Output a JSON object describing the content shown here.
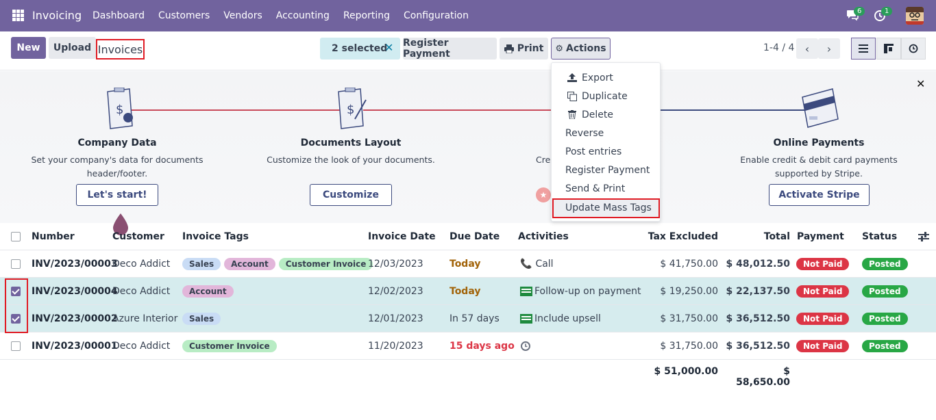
{
  "topbar": {
    "brand": "Invoicing",
    "menu": [
      "Dashboard",
      "Customers",
      "Vendors",
      "Accounting",
      "Reporting",
      "Configuration"
    ],
    "chat_count": "6",
    "activity_count": "1",
    "bg_color": "#71639e"
  },
  "control_panel": {
    "new_label": "New",
    "upload_label": "Upload",
    "breadcrumb": "Invoices",
    "selected_label": "2 selected",
    "register_payment_label": "Register Payment",
    "print_label": "Print",
    "actions_label": "Actions",
    "pager": "1-4 / 4"
  },
  "actions_menu": {
    "items": [
      {
        "label": "Export",
        "icon": "upload-icon"
      },
      {
        "label": "Duplicate",
        "icon": "copy-icon"
      },
      {
        "label": "Delete",
        "icon": "trash-icon"
      },
      {
        "label": "Reverse",
        "icon": ""
      },
      {
        "label": "Post entries",
        "icon": ""
      },
      {
        "label": "Register Payment",
        "icon": ""
      },
      {
        "label": "Send & Print",
        "icon": ""
      },
      {
        "label": "Update Mass Tags",
        "icon": ""
      }
    ]
  },
  "onboarding": {
    "steps": [
      {
        "title": "Company Data",
        "desc": "Set your company's data for documents header/footer.",
        "button": "Let's start!"
      },
      {
        "title": "Documents Layout",
        "desc": "Customize the look of your documents.",
        "button": "Customize"
      },
      {
        "title": "",
        "desc": "Crea",
        "button": ""
      },
      {
        "title": "Online Payments",
        "desc": "Enable credit & debit card payments supported by Stripe.",
        "button": "Activate Stripe"
      }
    ]
  },
  "table": {
    "headers": {
      "number": "Number",
      "customer": "Customer",
      "tags": "Invoice Tags",
      "invoice_date": "Invoice Date",
      "due_date": "Due Date",
      "activities": "Activities",
      "tax_excluded": "Tax Excluded",
      "total": "Total",
      "payment": "Payment",
      "status": "Status"
    },
    "rows": [
      {
        "number": "INV/2023/00003",
        "customer": "Deco Addict",
        "tags": [
          "Sales",
          "Account",
          "Customer Invoice"
        ],
        "invoice_date": "12/03/2023",
        "due_date": "Today",
        "activity": "Call",
        "activity_icon": "phone-icon",
        "tax_excluded": "$ 41,750.00",
        "total": "$ 48,012.50",
        "payment": "Not Paid",
        "status": "Posted",
        "selected": false
      },
      {
        "number": "INV/2023/00004",
        "customer": "Deco Addict",
        "tags": [
          "Account"
        ],
        "invoice_date": "12/02/2023",
        "due_date": "Today",
        "activity": "Follow-up on payment",
        "activity_icon": "money-icon",
        "tax_excluded": "$ 19,250.00",
        "total": "$ 22,137.50",
        "payment": "Not Paid",
        "status": "Posted",
        "selected": true
      },
      {
        "number": "INV/2023/00002",
        "customer": "Azure Interior",
        "tags": [
          "Sales"
        ],
        "invoice_date": "12/01/2023",
        "due_date": "In 57 days",
        "activity": "Include upsell",
        "activity_icon": "money-icon",
        "tax_excluded": "$ 31,750.00",
        "total": "$ 36,512.50",
        "payment": "Not Paid",
        "status": "Posted",
        "selected": true
      },
      {
        "number": "INV/2023/00001",
        "customer": "Deco Addict",
        "tags": [
          "Customer Invoice"
        ],
        "invoice_date": "11/20/2023",
        "due_date": "15 days ago",
        "activity": "",
        "activity_icon": "clock-icon",
        "tax_excluded": "$ 31,750.00",
        "total": "$ 36,512.50",
        "payment": "Not Paid",
        "status": "Posted",
        "selected": false
      }
    ],
    "totals": {
      "tax_excluded": "$ 51,000.00",
      "total": "$ 58,650.00"
    }
  }
}
